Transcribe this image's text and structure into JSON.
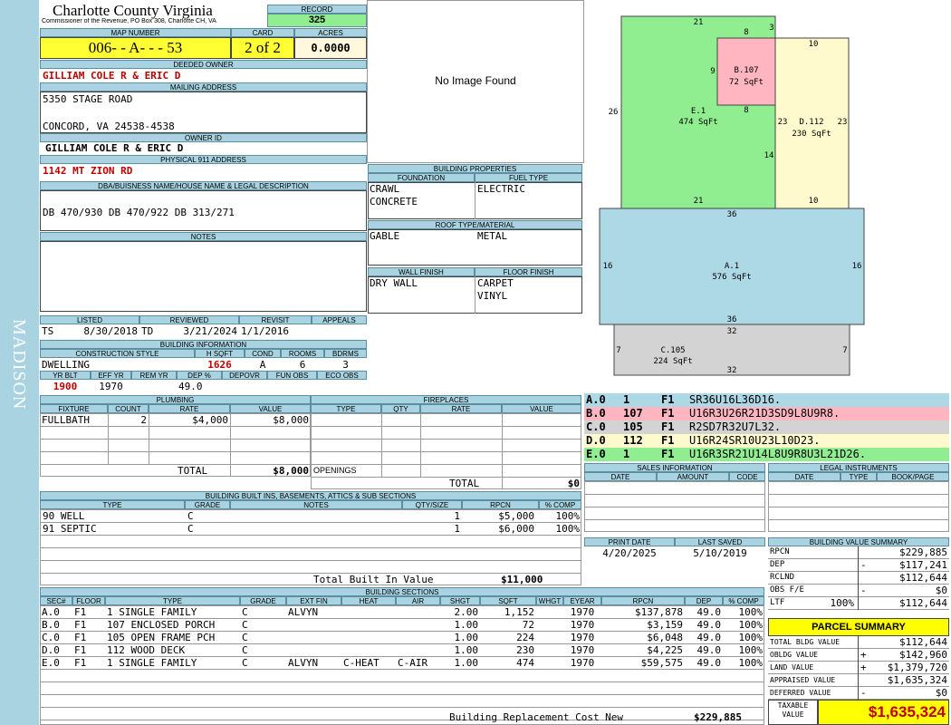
{
  "sidebar": {
    "district": "MADISON"
  },
  "header": {
    "county": "Charlotte County Virginia",
    "commissioner": "Commissioner of the Revenue, PO Box 308, Charlotte CH, VA",
    "record_label": "RECORD",
    "record": "325",
    "map_number_label": "MAP NUMBER",
    "map_number": "006- - A- - - 53",
    "card_label": "CARD",
    "card": "2 of 2",
    "acres_label": "ACRES",
    "acres": "0.0000"
  },
  "owner": {
    "deeded_label": "DEEDED OWNER",
    "deeded_owner": "GILLIAM COLE R & ERIC D",
    "mailing_label": "MAILING ADDRESS",
    "mailing_line1": "5350 STAGE ROAD",
    "mailing_line2": "CONCORD, VA 24538-4538",
    "owner_id_label": "OWNER ID",
    "owner_id": "GILLIAM COLE R & ERIC D",
    "physical_label": "PHYSICAL 911 ADDRESS",
    "physical_address": "1142 MT ZION RD",
    "dba_label": "DBA/BUISNESS NAME/HOUSE NAME & LEGAL DESCRIPTION",
    "legal": "DB 470/930 DB 470/922 DB 313/271",
    "notes_label": "NOTES"
  },
  "image_placeholder": "No Image Found",
  "building_properties": {
    "title": "BUILDING PROPERTIES",
    "foundation_label": "FOUNDATION",
    "foundation1": "CRAWL",
    "foundation2": "CONCRETE",
    "fuel_label": "FUEL TYPE",
    "fuel": "ELECTRIC",
    "roof_label": "ROOF TYPE/MATERIAL",
    "roof_type": "GABLE",
    "roof_material": "METAL",
    "wall_label": "WALL FINISH",
    "wall": "DRY WALL",
    "floor_label": "FLOOR FINISH",
    "floor1": "CARPET",
    "floor2": "VINYL"
  },
  "status": {
    "listed_label": "LISTED",
    "listed_by": "TS",
    "listed_date": "8/30/2018",
    "reviewed_label": "REVIEWED",
    "reviewed_by": "TD",
    "reviewed_date": "3/21/2024",
    "revisit_label": "REVISIT",
    "revisit_date": "1/1/2016",
    "appeals_label": "APPEALS"
  },
  "building_info": {
    "title": "BUILDING INFORMATION",
    "style_label": "CONSTRUCTION STYLE",
    "style": "DWELLING",
    "hsqft_label": "H SQFT",
    "hsqft": "1626",
    "cond_label": "COND",
    "cond": "A",
    "rooms_label": "ROOMS",
    "rooms": "6",
    "bdrms_label": "BDRMS",
    "bdrms": "3",
    "yrblt_label": "YR BLT",
    "yrblt": "1900",
    "effyr_label": "EFF YR",
    "effyr": "1970",
    "remyr_label": "REM YR",
    "dep_label": "DEP %",
    "dep": "49.0",
    "depovr_label": "DEPOVR",
    "funobs_label": "FUN OBS",
    "ecoobs_label": "ECO OBS"
  },
  "plumbing": {
    "title": "PLUMBING",
    "col_fixture": "FIXTURE",
    "col_count": "COUNT",
    "col_rate": "RATE",
    "col_value": "VALUE",
    "rows": [
      {
        "fixture": "FULLBATH",
        "count": "2",
        "rate": "$4,000",
        "value": "$8,000"
      }
    ],
    "total_label": "TOTAL",
    "total": "$8,000"
  },
  "fireplaces": {
    "title": "FIREPLACES",
    "col_type": "TYPE",
    "col_qty": "QTY",
    "col_rate": "RATE",
    "col_value": "VALUE",
    "openings_label": "OPENINGS",
    "total_label": "TOTAL",
    "total": "$0"
  },
  "builtins": {
    "title": "BUILDING BUILT INS, BASEMENTS, ATTICS & SUB SECTIONS",
    "col_type": "TYPE",
    "col_grade": "GRADE",
    "col_notes": "NOTES",
    "col_qty": "QTY/SIZE",
    "col_rpcn": "RPCN",
    "col_comp": "% COMP",
    "rows": [
      {
        "type": "90 WELL",
        "grade": "C",
        "notes": "",
        "qty": "1",
        "rpcn": "$5,000",
        "comp": "100%"
      },
      {
        "type": "91 SEPTIC",
        "grade": "C",
        "notes": "",
        "qty": "1",
        "rpcn": "$6,000",
        "comp": "100%"
      }
    ],
    "total_label": "Total Built In Value",
    "total": "$11,000"
  },
  "sections": {
    "title": "BUILDING SECTIONS",
    "cols": [
      "SEC#",
      "FLOOR",
      "TYPE",
      "GRADE",
      "EXT FIN",
      "HEAT",
      "AIR",
      "SHGT",
      "SQFT",
      "WHGT",
      "EYEAR",
      "RPCN",
      "DEP",
      "% COMP"
    ],
    "rows": [
      {
        "sec": "A.0",
        "floor": "F1",
        "type": "1 SINGLE FAMILY",
        "grade": "C",
        "ext": "ALVYN",
        "heat": "",
        "air": "",
        "shgt": "2.00",
        "sqft": "1,152",
        "whgt": "",
        "eyear": "1970",
        "rpcn": "$137,878",
        "dep": "49.0",
        "comp": "100%"
      },
      {
        "sec": "B.0",
        "floor": "F1",
        "type": "107 ENCLOSED PORCH",
        "grade": "C",
        "ext": "",
        "heat": "",
        "air": "",
        "shgt": "1.00",
        "sqft": "72",
        "whgt": "",
        "eyear": "1970",
        "rpcn": "$3,159",
        "dep": "49.0",
        "comp": "100%"
      },
      {
        "sec": "C.0",
        "floor": "F1",
        "type": "105 OPEN FRAME PCH",
        "grade": "C",
        "ext": "",
        "heat": "",
        "air": "",
        "shgt": "1.00",
        "sqft": "224",
        "whgt": "",
        "eyear": "1970",
        "rpcn": "$6,048",
        "dep": "49.0",
        "comp": "100%"
      },
      {
        "sec": "D.0",
        "floor": "F1",
        "type": "112 WOOD DECK",
        "grade": "C",
        "ext": "",
        "heat": "",
        "air": "",
        "shgt": "1.00",
        "sqft": "230",
        "whgt": "",
        "eyear": "1970",
        "rpcn": "$4,225",
        "dep": "49.0",
        "comp": "100%"
      },
      {
        "sec": "E.0",
        "floor": "F1",
        "type": "1 SINGLE FAMILY",
        "grade": "C",
        "ext": "ALVYN",
        "heat": "C-HEAT",
        "air": "C-AIR",
        "shgt": "1.00",
        "sqft": "474",
        "whgt": "",
        "eyear": "1970",
        "rpcn": "$59,575",
        "dep": "49.0",
        "comp": "100%"
      }
    ],
    "total_label": "Building Replacement Cost New",
    "total": "$229,885"
  },
  "sketch": {
    "areas": [
      {
        "label": "A.1",
        "sqft": "576 SqFt"
      },
      {
        "label": "B.107",
        "sqft": "72 SqFt"
      },
      {
        "label": "C.105",
        "sqft": "224 SqFt"
      },
      {
        "label": "D.112",
        "sqft": "230 SqFt"
      },
      {
        "label": "E.1",
        "sqft": "474 SqFt"
      }
    ],
    "dims": {
      "e_top": "21",
      "e_left": "26",
      "e_bottom": "21",
      "e_right": "14",
      "b_top": "8",
      "b_notch": "3",
      "b_left": "9",
      "b_bottom": "8",
      "d_top": "10",
      "d_left": "23",
      "d_right": "23",
      "d_bottom": "10",
      "a_top": "36",
      "a_left": "16",
      "a_right": "16",
      "a_bottom": "36",
      "c_top": "32",
      "c_left": "7",
      "c_right": "7",
      "c_bottom": "32"
    },
    "colors": {
      "A": "#add8e6",
      "B": "#ffb6c1",
      "C": "#d3d3d3",
      "D": "#fffacd",
      "E": "#90ee90"
    }
  },
  "sketch_legend": [
    {
      "sec": "A.0",
      "n": "1",
      "floor": "F1",
      "code": "SR36U16L36D16."
    },
    {
      "sec": "B.0",
      "n": "107",
      "floor": "F1",
      "code": "U16R3U26R21D3SD9L8U9R8."
    },
    {
      "sec": "C.0",
      "n": "105",
      "floor": "F1",
      "code": "R2SD7R32U7L32."
    },
    {
      "sec": "D.0",
      "n": "112",
      "floor": "F1",
      "code": "U16R24SR10U23L10D23."
    },
    {
      "sec": "E.0",
      "n": "1",
      "floor": "F1",
      "code": "U16R3SR21U14L8U9R8U3L21D26."
    }
  ],
  "sales": {
    "title": "SALES INFORMATION",
    "col_date": "DATE",
    "col_amount": "AMOUNT",
    "col_code": "CODE"
  },
  "legal_instruments": {
    "title": "LEGAL INSTRUMENTS",
    "col_date": "DATE",
    "col_type": "TYPE",
    "col_book": "BOOK/PAGE"
  },
  "dates": {
    "print_label": "PRINT DATE",
    "print": "4/20/2025",
    "saved_label": "LAST SAVED",
    "saved": "5/10/2019"
  },
  "value_summary": {
    "title": "BUILDING VALUE SUMMARY",
    "rows": [
      {
        "label": "RPCN",
        "sign": "",
        "value": "$229,885"
      },
      {
        "label": "DEP",
        "sign": "-",
        "value": "$117,241"
      },
      {
        "label": "RCLND",
        "sign": "",
        "value": "$112,644"
      },
      {
        "label": "OBS F/E",
        "sign": "-",
        "value": "$0"
      },
      {
        "label": "LTF",
        "pct": "100%",
        "sign": "",
        "value": "$112,644"
      }
    ]
  },
  "parcel_summary": {
    "title": "PARCEL SUMMARY",
    "rows": [
      {
        "label": "TOTAL BLDG VALUE",
        "sign": "",
        "value": "$112,644"
      },
      {
        "label": "OBLDG VALUE",
        "sign": "+",
        "value": "$142,960"
      },
      {
        "label": "LAND VALUE",
        "sign": "+",
        "value": "$1,379,720"
      },
      {
        "label": "APPRAISED VALUE",
        "sign": "",
        "value": "$1,635,324"
      },
      {
        "label": "DEFERRED VALUE",
        "sign": "-",
        "value": "$0"
      }
    ],
    "taxable_label_1": "TAXABLE",
    "taxable_label_2": "VALUE",
    "taxable": "$1,635,324"
  }
}
